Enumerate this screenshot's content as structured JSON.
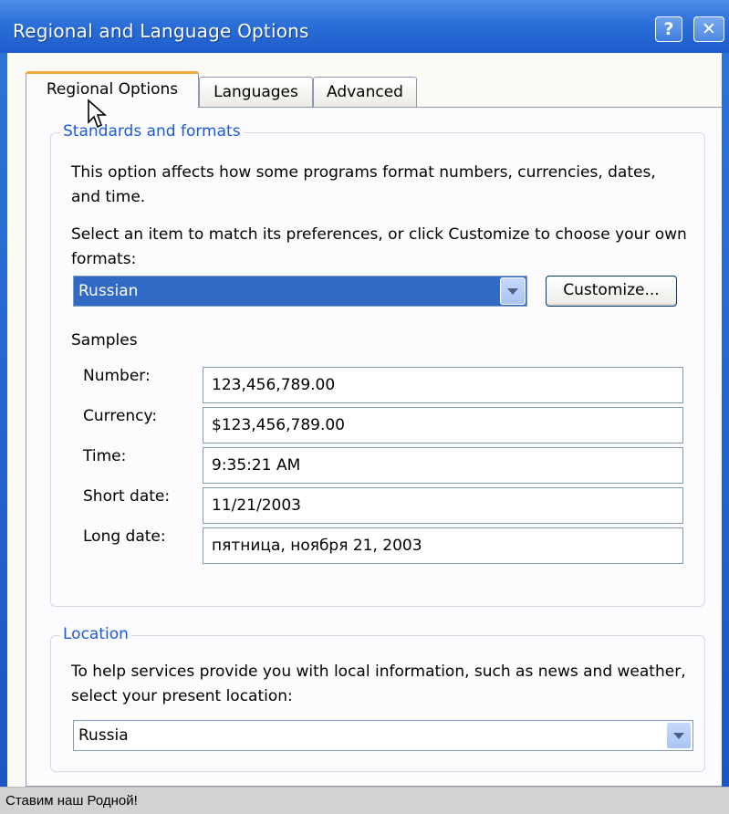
{
  "window": {
    "title": "Regional and Language Options",
    "help_glyph": "?",
    "close_glyph": "✕"
  },
  "tabs": [
    {
      "label": "Regional Options",
      "selected": true
    },
    {
      "label": "Languages",
      "selected": false
    },
    {
      "label": "Advanced",
      "selected": false
    }
  ],
  "standards": {
    "group_title": "Standards and formats",
    "description": "This option affects how some programs format numbers, currencies, dates, and time.",
    "instruction": "Select an item to match its preferences, or click Customize to choose your own formats:",
    "format_value": "Russian",
    "customize_label": "Customize...",
    "samples_heading": "Samples",
    "samples": [
      {
        "label": "Number:",
        "value": "123,456,789.00"
      },
      {
        "label": "Currency:",
        "value": "$123,456,789.00"
      },
      {
        "label": "Time:",
        "value": "9:35:21 AM"
      },
      {
        "label": "Short date:",
        "value": "11/21/2003"
      },
      {
        "label": "Long date:",
        "value": "пятница, ноября 21, 2003"
      }
    ]
  },
  "location": {
    "group_title": "Location",
    "description": "To help services provide you with local information, such as news and weather, select your present location:",
    "value": "Russia"
  },
  "caption": "Ставим наш Родной!",
  "colors": {
    "titlebar": "#2b6fd8",
    "group_title": "#1c5bd7",
    "selection": "#316ac5",
    "active_tab_accent": "#f3a83b"
  }
}
